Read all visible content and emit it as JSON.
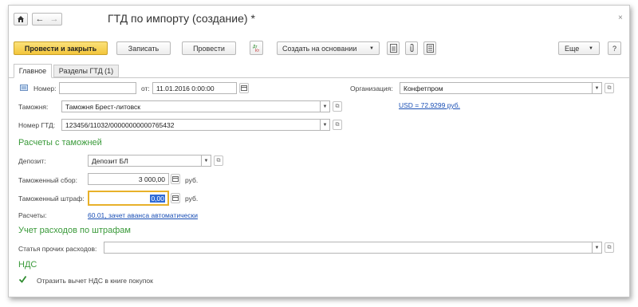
{
  "title": "ГТД по импорту (создание) *",
  "toolbar": {
    "post_close": "Провести и закрыть",
    "save": "Записать",
    "post": "Провести",
    "create_based": "Создать на основании",
    "more": "Еще",
    "help": "?"
  },
  "tabs": [
    {
      "label": "Главное",
      "active": true
    },
    {
      "label": "Разделы ГТД (1)",
      "active": false
    }
  ],
  "form": {
    "number_label": "Номер:",
    "number_value": "",
    "date_label": "от:",
    "date_value": "11.01.2016  0:00:00",
    "org_label": "Организация:",
    "org_value": "Конфетпром",
    "rate_link": "USD = 72.9299 руб.",
    "customs_label": "Таможня:",
    "customs_value": "Таможня Брест-литовск",
    "gtd_label": "Номер ГТД:",
    "gtd_value": "123456/11032/00000000000765432"
  },
  "settlements": {
    "heading": "Расчеты с таможней",
    "deposit_label": "Депозит:",
    "deposit_value": "Депозит БЛ",
    "fee_label": "Таможенный сбор:",
    "fee_value": "3 000,00",
    "fee_unit": "руб.",
    "fine_label": "Таможенный штраф:",
    "fine_value": "0,00",
    "fine_unit": "руб.",
    "calc_label": "Расчеты:",
    "calc_link": "60.01, зачет аванса автоматически"
  },
  "fines": {
    "heading": "Учет расходов по штрафам",
    "other_label": "Статья прочих расходов:",
    "other_value": ""
  },
  "vat": {
    "heading": "НДС",
    "checkbox_label": "Отразить вычет НДС в книге покупок",
    "checked": true
  },
  "colors": {
    "accent": "#f3c53b",
    "section": "#3a9a3a",
    "link": "#1a4fb5",
    "focus": "#e8b12a"
  }
}
